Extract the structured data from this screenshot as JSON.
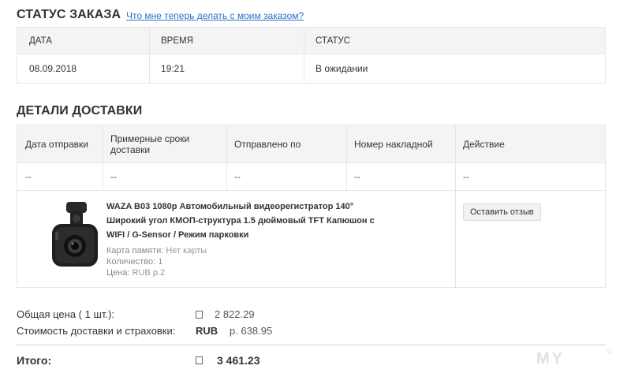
{
  "order_status": {
    "title": "СТАТУС ЗАКАЗА",
    "help_link": "Что мне теперь делать с моим заказом?",
    "columns": [
      "ДАТА",
      "ВРЕМЯ",
      "СТАТУС"
    ],
    "row": {
      "date": "08.09.2018",
      "time": "19:21",
      "status": "В ожидании"
    }
  },
  "delivery": {
    "title": "ДЕТАЛИ ДОСТАВКИ",
    "columns": [
      "Дата отправки",
      "Примерные сроки доставки",
      "Отправлено по",
      "Номер накладной",
      "Действие"
    ],
    "row": [
      "--",
      "--",
      "--",
      "--",
      "--"
    ]
  },
  "product": {
    "title": "WAZA B03 1080p Автомобильный видеорегистратор 140° Широкий угол КМОП-структура 1.5 дюймовый TFT Капюшон с WIFI / G-Sensor / Режим парковки",
    "memory_card_label": "Карта памяти:",
    "memory_card_value": "Нет карты",
    "quantity_label": "Количество:",
    "quantity_value": "1",
    "price_label": "Цена:",
    "price_value": "RUB р.2",
    "review_button": "Оставить отзыв",
    "image_icon": "dashcam-icon"
  },
  "totals": {
    "subtotal_label": "Общая цена ( 1 шт.):",
    "subtotal_value": "2 822.29",
    "shipping_label": "Стоимость доставки и страховки:",
    "shipping_currency": "RUB",
    "shipping_value": "р. 638.95",
    "grand_label": "Итого:",
    "grand_value": "3 461.23"
  },
  "watermark": {
    "text": "MY",
    "suffix": ".ru"
  },
  "colors": {
    "link": "#2a6fc9",
    "header_bg": "#f4f4f4",
    "border": "#e6e6e6"
  }
}
